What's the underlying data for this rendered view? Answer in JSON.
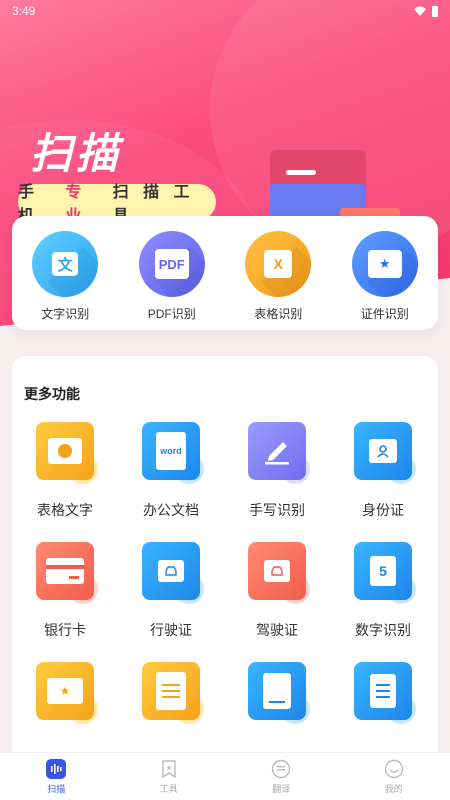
{
  "status": {
    "time": "3:49"
  },
  "hero": {
    "title": "扫描",
    "tag_part1": "手 机 ",
    "tag_highlight": "专 业",
    "tag_part2": " 扫 描 工 具"
  },
  "top_features": [
    {
      "label": "文字识别",
      "glyph": "文",
      "icon": "text-recognition-icon",
      "color": "#2aa3f5"
    },
    {
      "label": "PDF识别",
      "glyph": "PDF",
      "icon": "pdf-icon",
      "color": "#5f63f0"
    },
    {
      "label": "表格识别",
      "glyph": "X",
      "icon": "table-icon",
      "color": "#f59b14"
    },
    {
      "label": "证件识别",
      "glyph": "★",
      "icon": "id-card-icon",
      "color": "#2f6ef5"
    }
  ],
  "more": {
    "title": "更多功能",
    "items": [
      {
        "label": "表格文字",
        "icon": "camera-icon"
      },
      {
        "label": "办公文档",
        "icon": "word-document-icon",
        "glyph": "word"
      },
      {
        "label": "手写识别",
        "icon": "pen-write-icon"
      },
      {
        "label": "身份证",
        "icon": "id-person-icon"
      },
      {
        "label": "银行卡",
        "icon": "bank-card-icon"
      },
      {
        "label": "行驶证",
        "icon": "vehicle-license-icon"
      },
      {
        "label": "驾驶证",
        "icon": "driver-license-icon"
      },
      {
        "label": "数字识别",
        "icon": "number-recognition-icon",
        "glyph": "5"
      },
      {
        "label": "",
        "icon": "certificate-icon"
      },
      {
        "label": "",
        "icon": "document-scroll-icon"
      },
      {
        "label": "",
        "icon": "book-icon"
      },
      {
        "label": "",
        "icon": "receipt-icon"
      }
    ]
  },
  "tabbar": [
    {
      "label": "扫描",
      "icon": "scan-icon",
      "active": true
    },
    {
      "label": "工具",
      "icon": "bookmark-icon",
      "active": false
    },
    {
      "label": "翻译",
      "icon": "translate-icon",
      "active": false
    },
    {
      "label": "我的",
      "icon": "smile-icon",
      "active": false
    }
  ]
}
